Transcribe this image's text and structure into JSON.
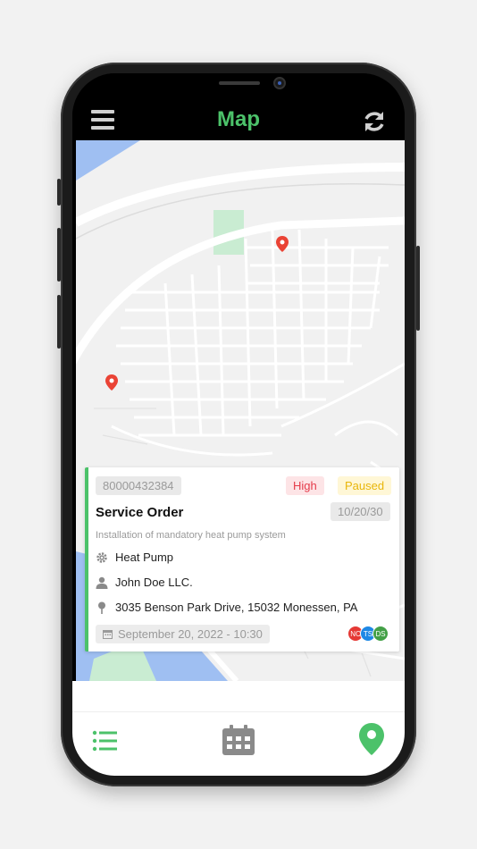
{
  "header": {
    "title": "Map"
  },
  "card": {
    "order_id": "80000432384",
    "priority": "High",
    "status": "Paused",
    "date_range": "10/20/30",
    "title": "Service Order",
    "description": "Installation of mandatory heat pump system",
    "equipment": "Heat Pump",
    "customer": "John Doe LLC.",
    "address": "3035 Benson Park Drive, 15032 Monessen, PA",
    "datetime": "September 20, 2022 - 10:30",
    "assignees": [
      {
        "initials": "NC",
        "color": "#e53935"
      },
      {
        "initials": "TS",
        "color": "#1e88e5"
      },
      {
        "initials": "DS",
        "color": "#43a047"
      }
    ]
  },
  "icons": {
    "menu": "menu-icon",
    "refresh": "refresh-icon",
    "equipment": "gear-icon",
    "customer": "person-icon",
    "address": "location-pin-icon",
    "date": "calendar-icon",
    "nav_list": "list-icon",
    "nav_calendar": "calendar-icon",
    "nav_map": "map-pin-icon"
  },
  "colors": {
    "accent": "#4cc26a",
    "priority": "#e53b4a",
    "status": "#e8b60b",
    "river": "#9fbff2",
    "park": "#c9ecd2"
  }
}
